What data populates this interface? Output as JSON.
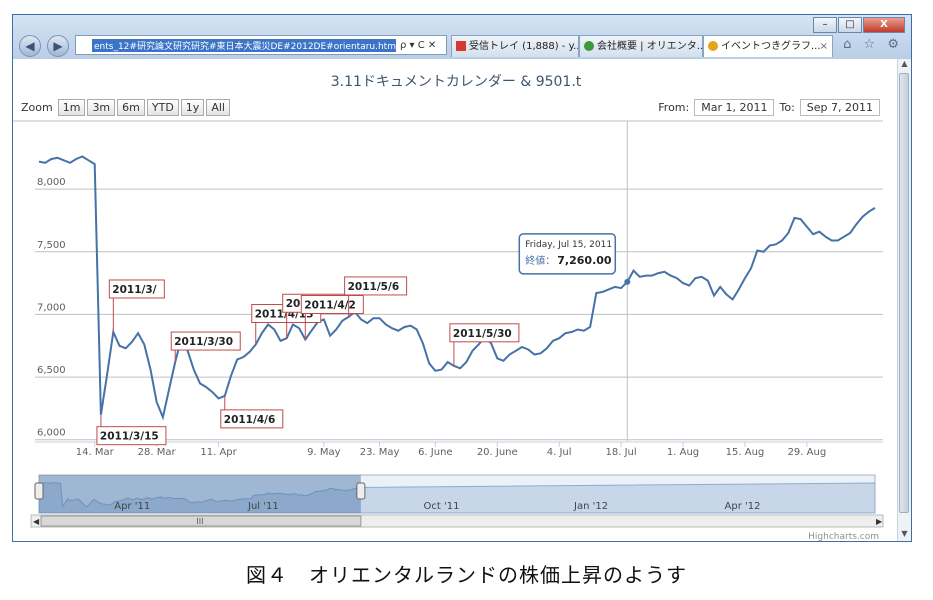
{
  "browser": {
    "address_url": "ents_12#研究論文研究研究#東日本大震災DE#2012DE#orientaru.htm",
    "address_controls": "ρ ▾ C ✕",
    "tabs": [
      {
        "label": "受信トレイ (1,888) - y...",
        "icon": "gmail-icon"
      },
      {
        "label": "会社概要 | オリエンタ...",
        "icon": "chrome-icon"
      },
      {
        "label": "イベントつきグラフ...",
        "icon": "ie-icon",
        "close": "×"
      }
    ],
    "window_controls": {
      "minimize": "–",
      "maximize": "□",
      "close": "X"
    },
    "toolbar_icons": "⌂ ☆ ⚙"
  },
  "chart_data": {
    "type": "line",
    "title": "3.11ドキュメントカレンダー & 9501.t",
    "zoom_label": "Zoom",
    "zoom_buttons": [
      "1m",
      "3m",
      "6m",
      "YTD",
      "1y",
      "All"
    ],
    "from_label": "From:",
    "from_value": "Mar 1, 2011",
    "to_label": "To:",
    "to_value": "Sep 7, 2011",
    "y_ticks": [
      6000,
      6500,
      7000,
      7500,
      8000
    ],
    "y_tick_labels": [
      "6,000",
      "6,500",
      "7,000",
      "7,500",
      "8,000"
    ],
    "ylim": [
      5990,
      8400
    ],
    "x_ticks": [
      "14. Mar",
      "28. Mar",
      "11. Apr",
      "9. May",
      "23. May",
      "6. June",
      "20. June",
      "4. Jul",
      "18. Jul",
      "1. Aug",
      "15. Aug",
      "29. Aug"
    ],
    "tick_index": [
      9,
      19,
      29,
      46,
      55,
      64,
      74,
      84,
      94,
      104,
      114,
      124
    ],
    "series": [
      {
        "name": "9501.t",
        "color": "#4572a7",
        "values": [
          8220,
          8210,
          8240,
          8250,
          8230,
          8210,
          8240,
          8260,
          8230,
          8200,
          6200,
          6520,
          6860,
          6750,
          6730,
          6780,
          6850,
          6760,
          6560,
          6300,
          6180,
          6400,
          6620,
          6810,
          6710,
          6560,
          6450,
          6420,
          6380,
          6330,
          6350,
          6510,
          6640,
          6660,
          6700,
          6760,
          6850,
          6920,
          6880,
          6790,
          6810,
          6920,
          6890,
          6800,
          6870,
          6940,
          6960,
          6830,
          6880,
          6950,
          6980,
          7020,
          6960,
          6930,
          6970,
          6970,
          6920,
          6890,
          6870,
          6900,
          6910,
          6880,
          6770,
          6610,
          6550,
          6560,
          6620,
          6590,
          6570,
          6620,
          6710,
          6760,
          6820,
          6770,
          6650,
          6630,
          6680,
          6710,
          6740,
          6720,
          6680,
          6690,
          6730,
          6790,
          6810,
          6850,
          6860,
          6880,
          6870,
          6900,
          7170,
          7180,
          7200,
          7220,
          7210,
          7260,
          7350,
          7300,
          7310,
          7310,
          7330,
          7340,
          7310,
          7290,
          7250,
          7230,
          7290,
          7300,
          7270,
          7150,
          7220,
          7160,
          7120,
          7200,
          7290,
          7370,
          7510,
          7500,
          7550,
          7560,
          7590,
          7650,
          7770,
          7760,
          7700,
          7640,
          7660,
          7620,
          7590,
          7590,
          7620,
          7650,
          7720,
          7780,
          7820,
          7850
        ]
      }
    ],
    "flags": [
      {
        "label": "2011/3/15",
        "index": 10
      },
      {
        "label": "2011/3/",
        "index": 12
      },
      {
        "label": "2011/3/30",
        "index": 22
      },
      {
        "label": "2011/4/6",
        "index": 30
      },
      {
        "label": "2011/4/13",
        "index": 35
      },
      {
        "label": "2011/4/15",
        "index": 40
      },
      {
        "label": "2011/4/2",
        "index": 43
      },
      {
        "label": "2011/5/6",
        "index": 50
      },
      {
        "label": "2011/5/30",
        "index": 67
      }
    ],
    "tooltip": {
      "date": "Friday, Jul 15, 2011",
      "label": "終値",
      "value": "7,260.00",
      "index": 95
    },
    "navigator": {
      "labels": [
        "Apr '11",
        "Jul '11",
        "Oct '11",
        "Jan '12",
        "Apr '12"
      ],
      "scroll_mark": "III"
    },
    "credits": "Highcharts.com"
  },
  "caption": "図４　オリエンタルランドの株価上昇のようす"
}
